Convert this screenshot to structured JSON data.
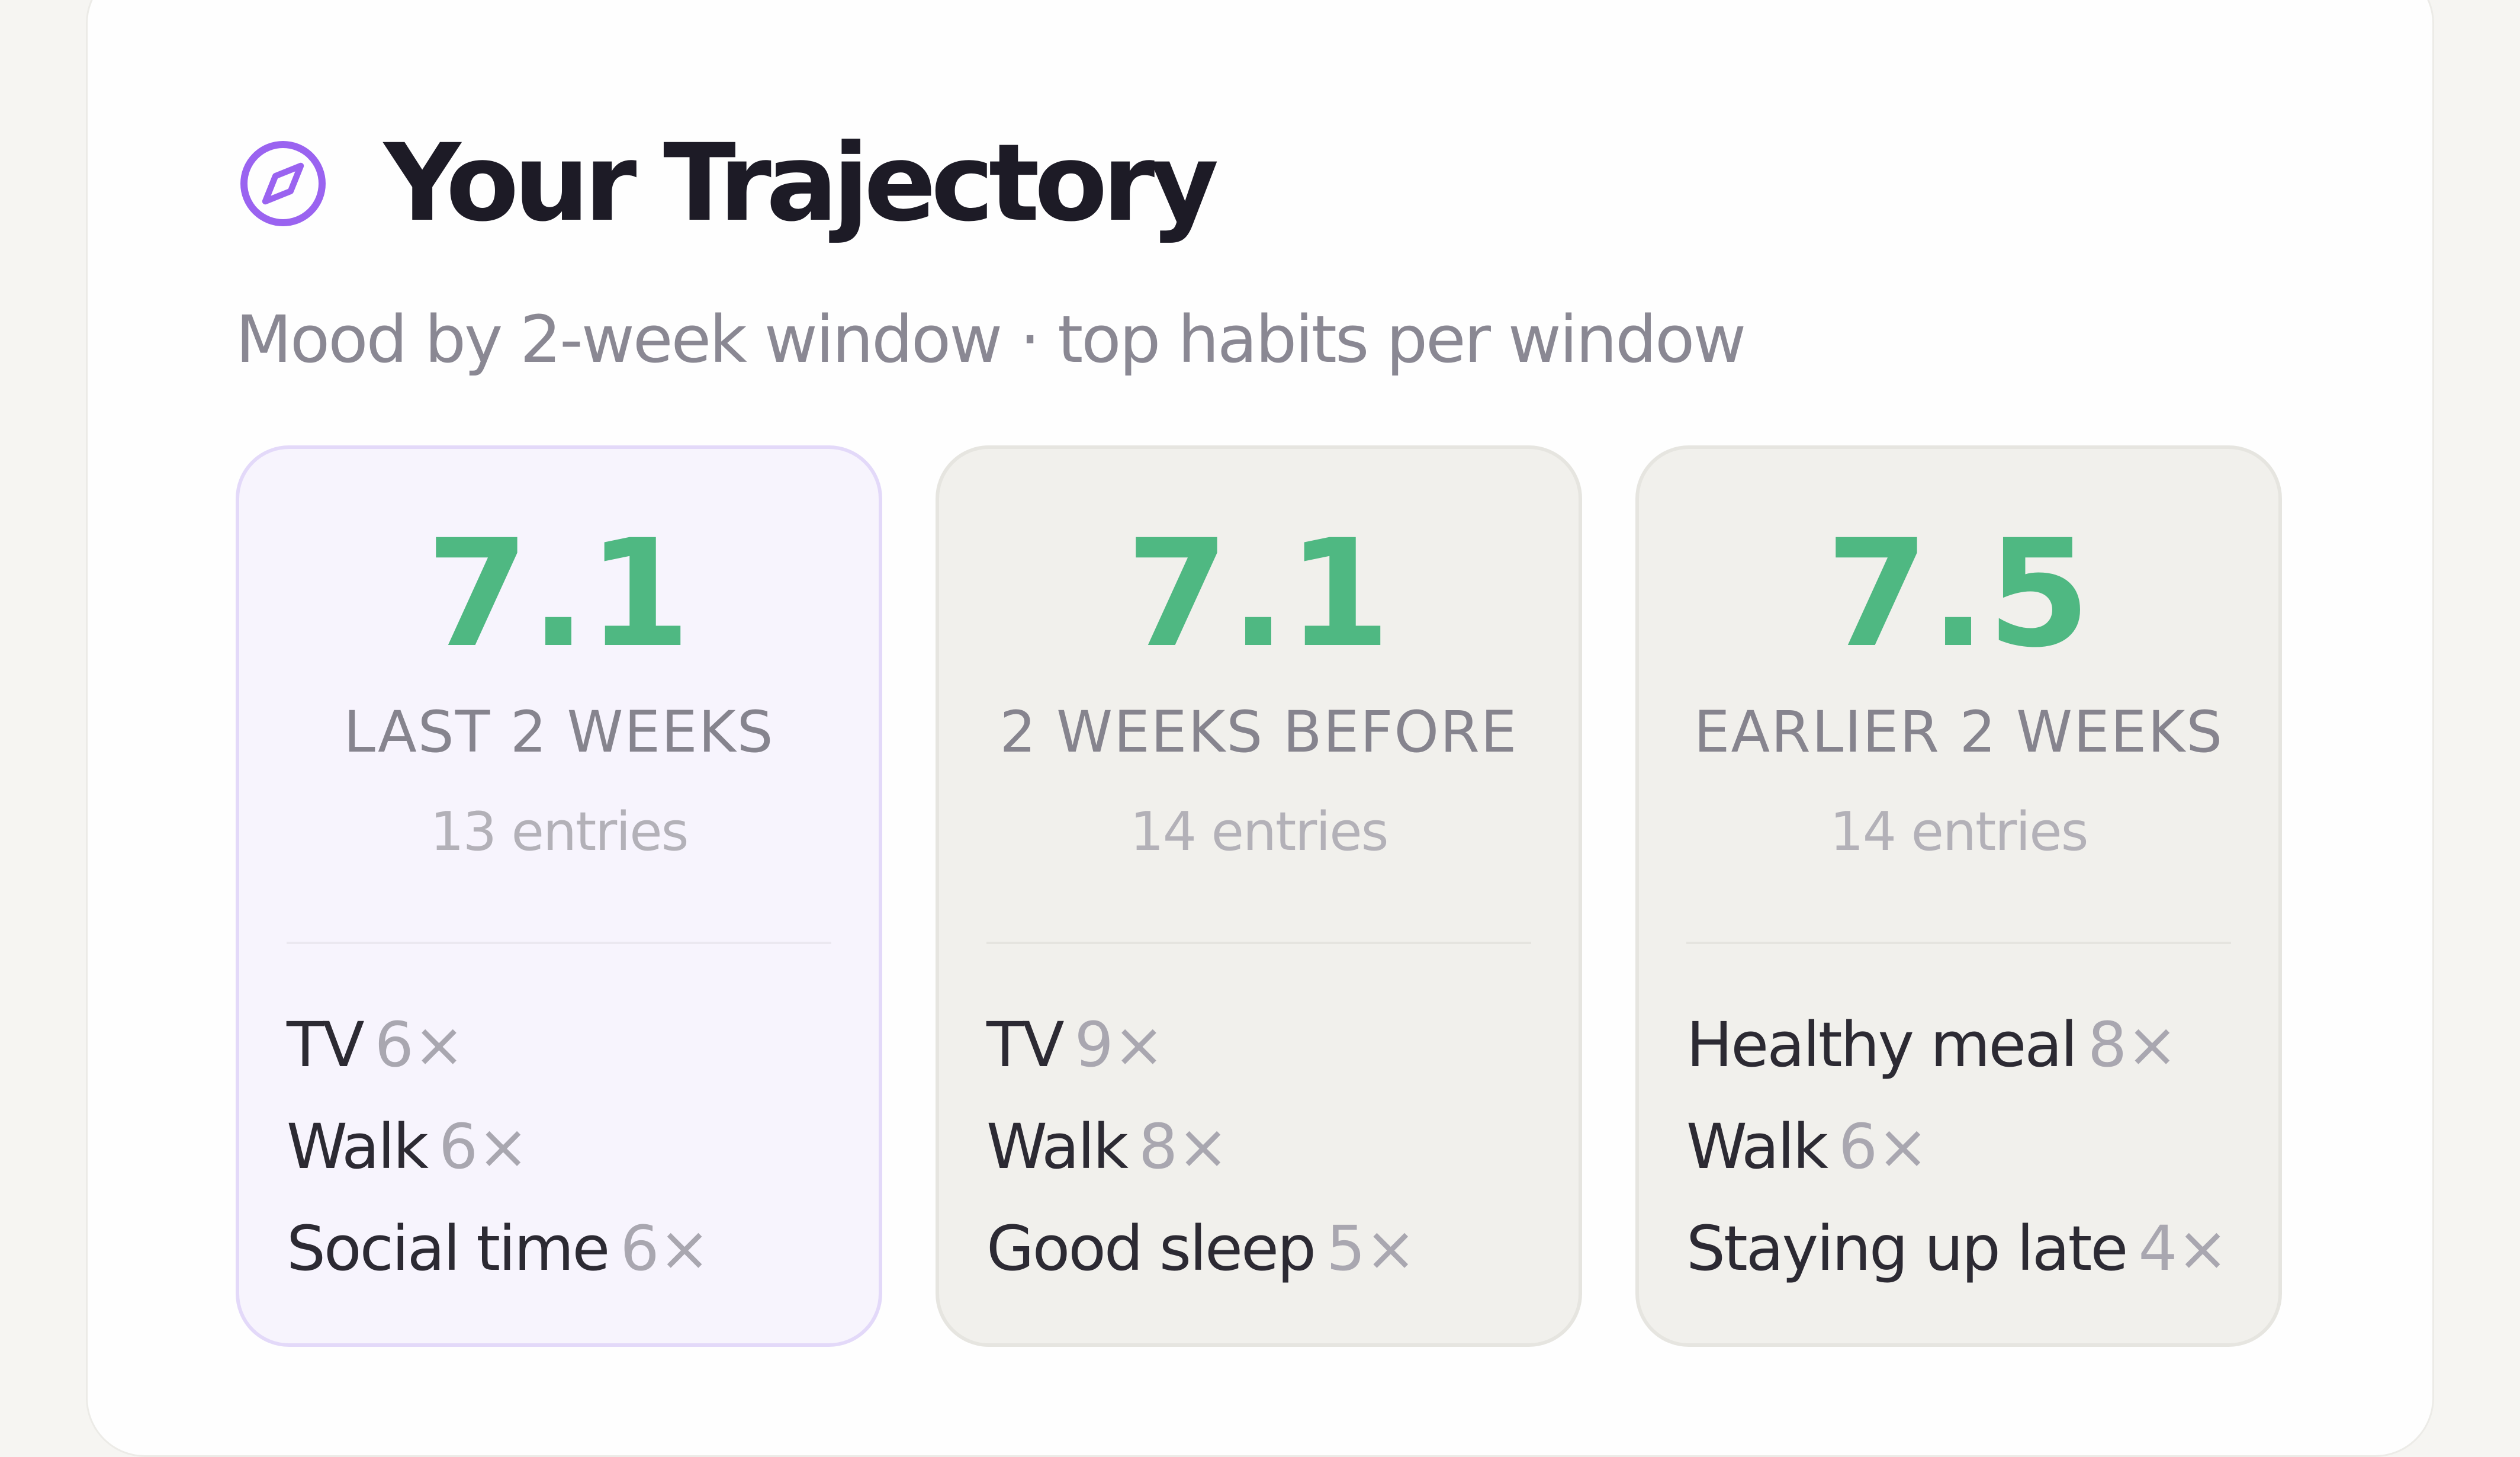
{
  "section": {
    "icon": "compass-icon",
    "title": "Your Trajectory",
    "subtitle": "Mood by 2-week window · top habits per window"
  },
  "colors": {
    "accent": "#9a63f0",
    "score_green": "#4fb882",
    "current_bg": "#f7f4fd",
    "current_border": "#e3d9f9",
    "past_bg": "#f1f0ec"
  },
  "windows": [
    {
      "score": "7.1",
      "label": "LAST 2 WEEKS",
      "entries": "13 entries",
      "habits": [
        {
          "name": "TV",
          "count": "6×"
        },
        {
          "name": "Walk",
          "count": "6×"
        },
        {
          "name": "Social time",
          "count": "6×"
        }
      ]
    },
    {
      "score": "7.1",
      "label": "2 WEEKS BEFORE",
      "entries": "14 entries",
      "habits": [
        {
          "name": "TV",
          "count": "9×"
        },
        {
          "name": "Walk",
          "count": "8×"
        },
        {
          "name": "Good sleep",
          "count": "5×"
        }
      ]
    },
    {
      "score": "7.5",
      "label": "EARLIER 2 WEEKS",
      "entries": "14 entries",
      "habits": [
        {
          "name": "Healthy meal",
          "count": "8×"
        },
        {
          "name": "Walk",
          "count": "6×"
        },
        {
          "name": "Staying up late",
          "count": "4×"
        }
      ]
    }
  ]
}
